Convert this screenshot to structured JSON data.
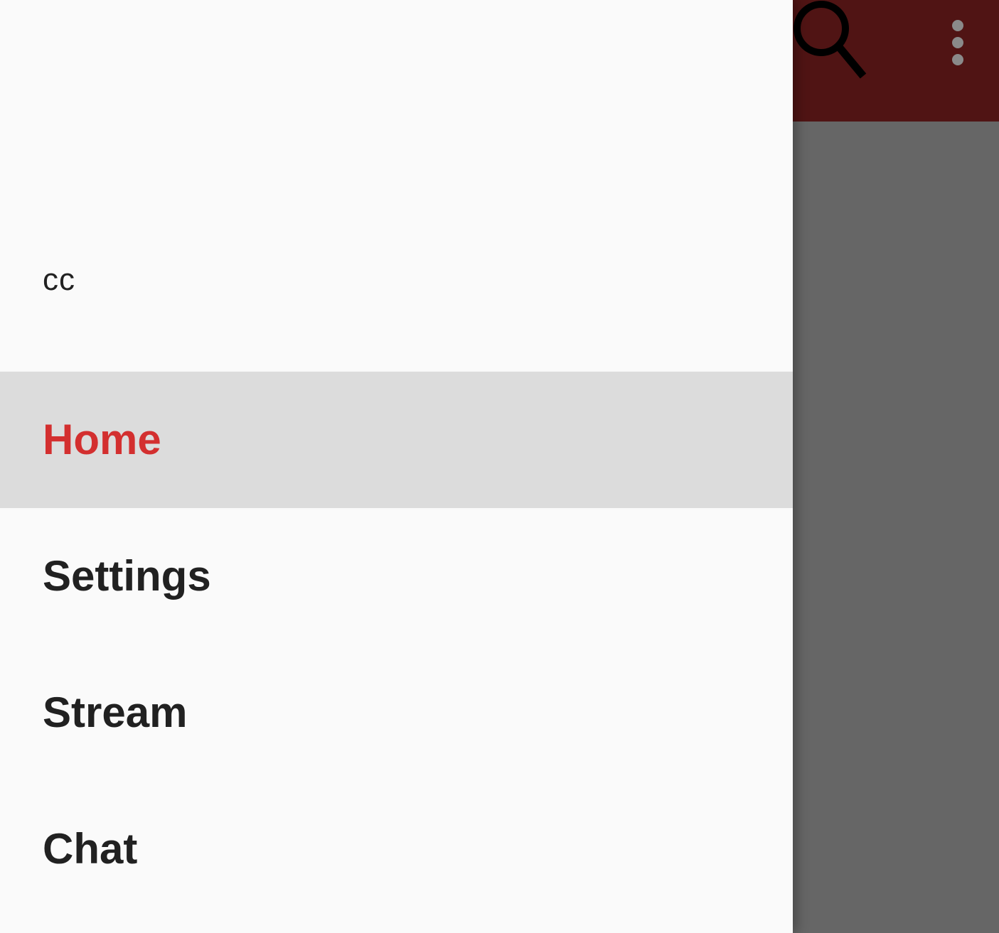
{
  "colors": {
    "toolbar_background": "#501414",
    "scrim_background": "#666666",
    "drawer_background": "#fafafa",
    "active_item_background": "#dcdcdc",
    "active_item_text": "#d32f2f",
    "item_text": "#212121"
  },
  "toolbar": {
    "search_icon": "search-icon",
    "overflow_icon": "more-vert-icon"
  },
  "drawer": {
    "header": {
      "username": "cc"
    },
    "items": [
      {
        "label": "Home",
        "selected": true
      },
      {
        "label": "Settings",
        "selected": false
      },
      {
        "label": "Stream",
        "selected": false
      },
      {
        "label": "Chat",
        "selected": false
      }
    ]
  }
}
